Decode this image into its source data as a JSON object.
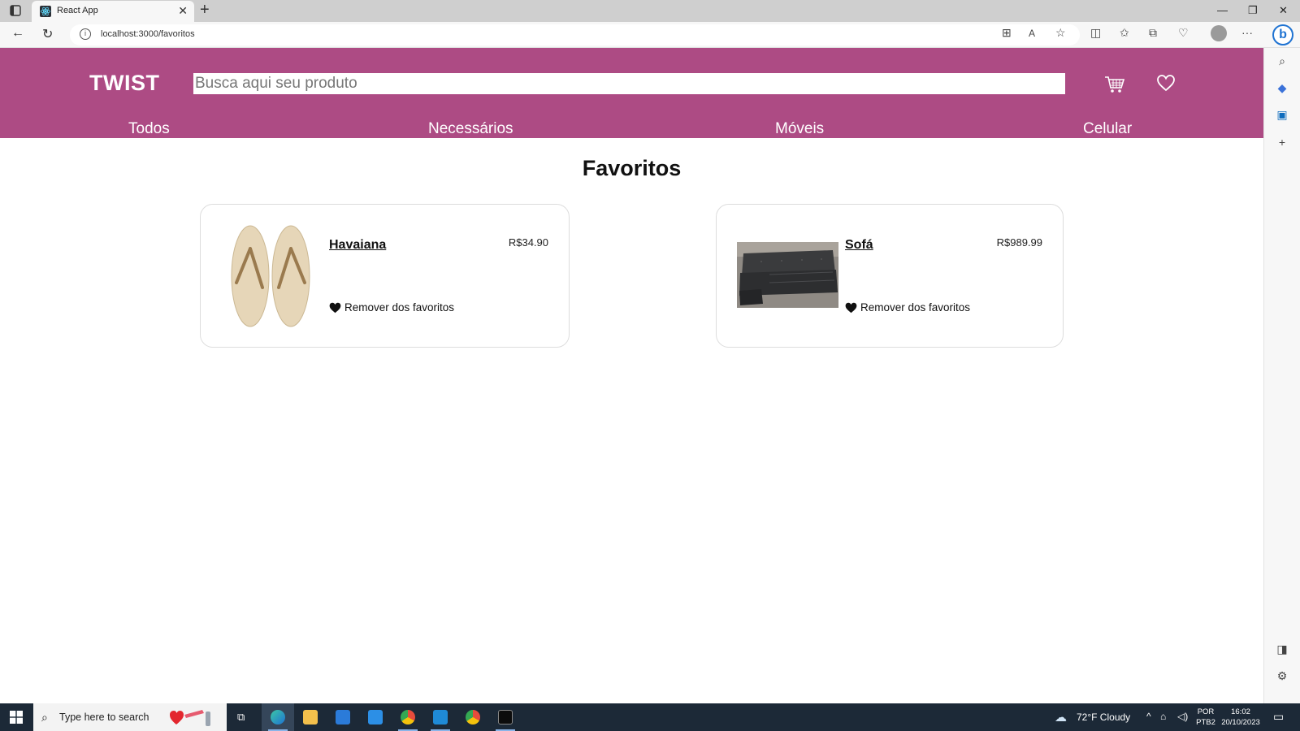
{
  "browser": {
    "tab_title": "React App",
    "tab_close": "✕",
    "new_tab": "+",
    "url": "localhost:3000/favoritos",
    "win_min": "—",
    "win_restore": "❐",
    "win_close": "✕",
    "accent": "#1f73d2"
  },
  "site": {
    "brand": "TWIST",
    "brand_color": "#ad4b84",
    "search_placeholder": "Busca aqui seu produto",
    "categories": [
      "Todos",
      "Necessários",
      "Móveis",
      "Celular"
    ]
  },
  "main": {
    "title": "Favoritos",
    "products": [
      {
        "name": "Havaiana",
        "price": "R$34.90",
        "action": "Remover dos favoritos",
        "image": "flip-flops"
      },
      {
        "name": "Sofá",
        "price": "R$989.99",
        "action": "Remover dos favoritos",
        "image": "sofa"
      }
    ]
  },
  "taskbar": {
    "search_placeholder": "Type here to search",
    "weather": "72°F  Cloudy",
    "lang_top": "POR",
    "lang_bottom": "PTB2",
    "time": "16:02",
    "date": "20/10/2023"
  }
}
